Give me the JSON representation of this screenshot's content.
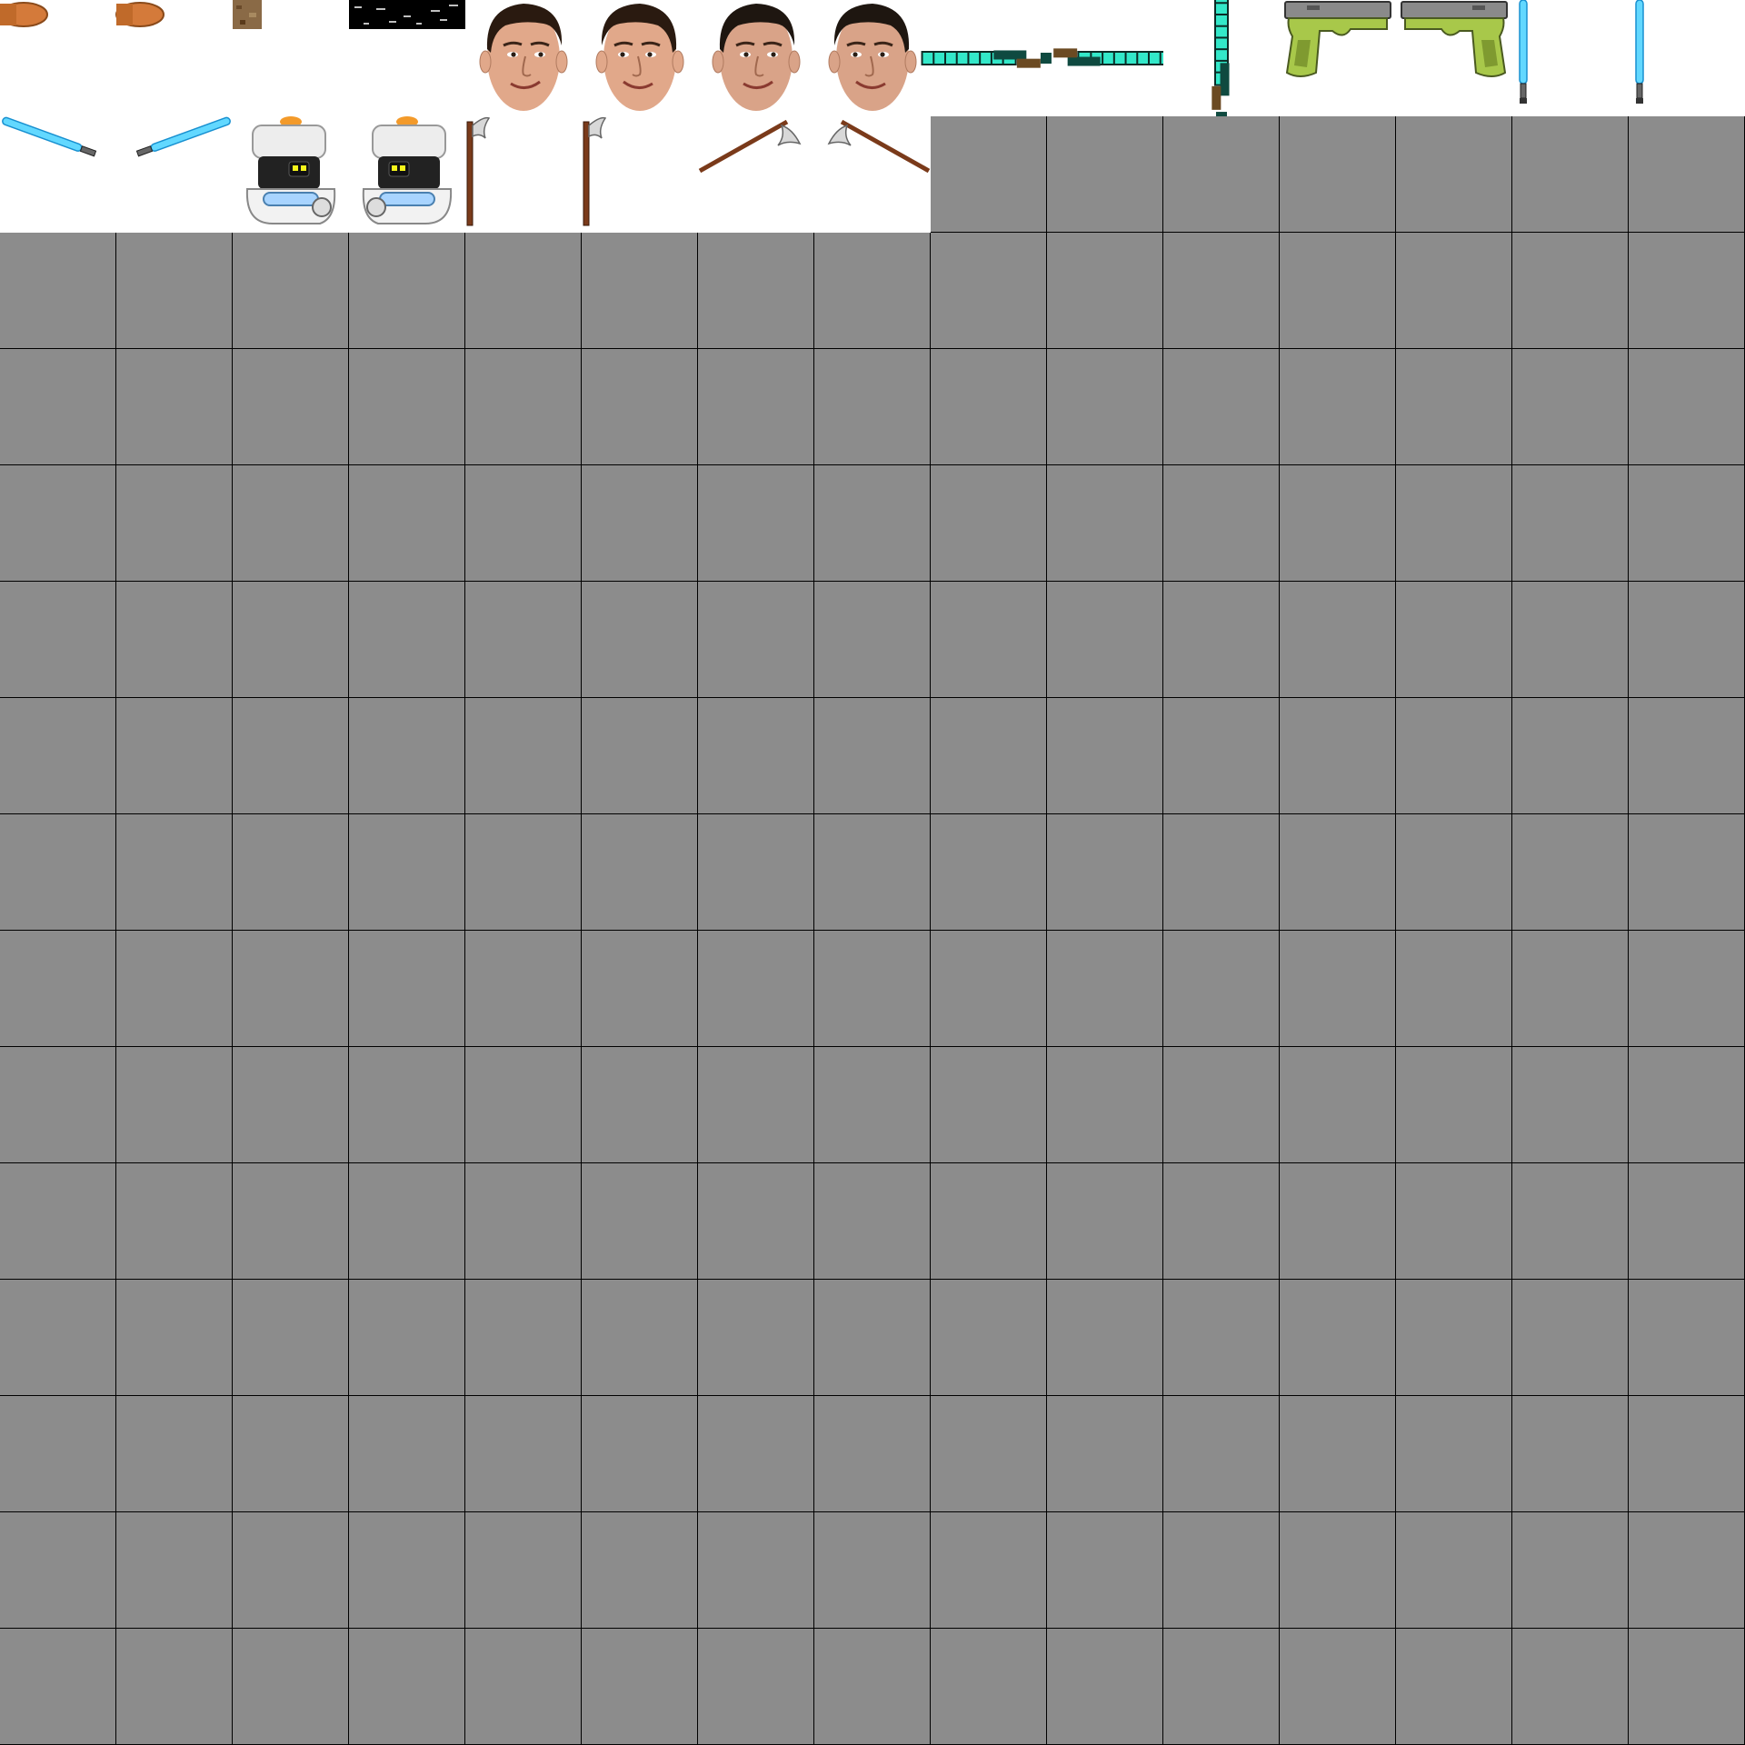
{
  "sheet": {
    "columns": 15,
    "rows": 15,
    "colors": {
      "empty_cell": "#8c8c8c",
      "filled_cell": "#ffffff",
      "grid_line": "#000000"
    },
    "sprites": [
      {
        "index": 0,
        "name": "bullet-right"
      },
      {
        "index": 1,
        "name": "bullet-left"
      },
      {
        "index": 2,
        "name": "dirt-block"
      },
      {
        "index": 3,
        "name": "black-strip-texture"
      },
      {
        "index": 4,
        "name": "face-a-right"
      },
      {
        "index": 5,
        "name": "face-a-left"
      },
      {
        "index": 6,
        "name": "face-b-right"
      },
      {
        "index": 7,
        "name": "face-b-left"
      },
      {
        "index": 8,
        "name": "diamond-sword-left"
      },
      {
        "index": 9,
        "name": "diamond-sword-right"
      },
      {
        "index": 10,
        "name": "diamond-sword-down"
      },
      {
        "index": 11,
        "name": "pistol-left"
      },
      {
        "index": 12,
        "name": "pistol-right"
      },
      {
        "index": 13,
        "name": "lightsaber-vertical"
      },
      {
        "index": 14,
        "name": "lightsaber-vertical-2"
      },
      {
        "index": 15,
        "name": "lightsaber-diagonal-right"
      },
      {
        "index": 16,
        "name": "lightsaber-diagonal-left"
      },
      {
        "index": 17,
        "name": "robot-right"
      },
      {
        "index": 18,
        "name": "robot-left"
      },
      {
        "index": 19,
        "name": "axe-right"
      },
      {
        "index": 20,
        "name": "axe-left"
      },
      {
        "index": 21,
        "name": "axe-swing-right"
      },
      {
        "index": 22,
        "name": "axe-swing-left"
      }
    ]
  }
}
